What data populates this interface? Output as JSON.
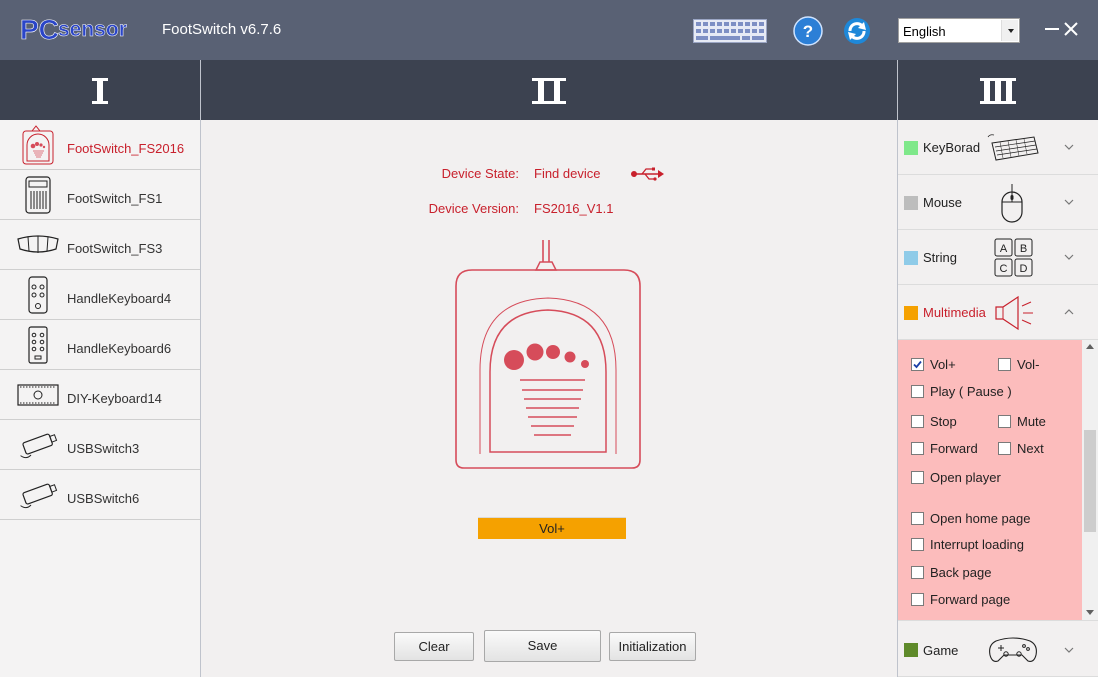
{
  "title_bar": {
    "logo_text": "PCsensor",
    "app_title": "FootSwitch v6.7.6",
    "language": "English"
  },
  "columns": {
    "left_header": "I",
    "middle_header": "II",
    "right_header": "III"
  },
  "devices": [
    {
      "label": "FootSwitch_FS2016",
      "icon": "footswitch-fs2016-icon",
      "active": true
    },
    {
      "label": "FootSwitch_FS1",
      "icon": "footswitch-fs1-icon",
      "active": false
    },
    {
      "label": "FootSwitch_FS3",
      "icon": "footswitch-fs3-icon",
      "active": false
    },
    {
      "label": "HandleKeyboard4",
      "icon": "handle-keyboard4-icon",
      "active": false
    },
    {
      "label": "HandleKeyboard6",
      "icon": "handle-keyboard6-icon",
      "active": false
    },
    {
      "label": "DIY-Keyboard14",
      "icon": "diy-keyboard14-icon",
      "active": false
    },
    {
      "label": "USBSwitch3",
      "icon": "usb-switch3-icon",
      "active": false
    },
    {
      "label": "USBSwitch6",
      "icon": "usb-switch6-icon",
      "active": false
    }
  ],
  "device_info": {
    "state_label": "Device State:",
    "state_value": "Find device",
    "version_label": "Device Version:",
    "version_value": "FS2016_V1.1"
  },
  "assigned_key": "Vol+",
  "buttons": {
    "clear": "Clear",
    "save": "Save",
    "init": "Initialization"
  },
  "categories": [
    {
      "label": "KeyBorad",
      "color": "#7fe88a",
      "icon": "keyboard-icon",
      "open": false
    },
    {
      "label": "Mouse",
      "color": "#bdbdbd",
      "icon": "mouse-icon",
      "open": false
    },
    {
      "label": "String",
      "color": "#8fcbe8",
      "icon": "string-abcd-icon",
      "open": false
    },
    {
      "label": "Multimedia",
      "color": "#f5a100",
      "icon": "speaker-icon",
      "open": true
    },
    {
      "label": "Game",
      "color": "#5f8a2a",
      "icon": "gamepad-icon",
      "open": false
    }
  ],
  "string_icon_letters": [
    "A",
    "B",
    "C",
    "D"
  ],
  "multimedia_options": [
    {
      "label": "Vol+",
      "checked": true
    },
    {
      "label": "Vol-",
      "checked": false
    },
    {
      "label": "Play ( Pause )",
      "checked": false
    },
    {
      "label": "Stop",
      "checked": false
    },
    {
      "label": "Mute",
      "checked": false
    },
    {
      "label": "Forward",
      "checked": false
    },
    {
      "label": "Next",
      "checked": false
    },
    {
      "label": "Open player",
      "checked": false
    },
    {
      "label": "Open home page",
      "checked": false
    },
    {
      "label": "Interrupt loading",
      "checked": false
    },
    {
      "label": "Back page",
      "checked": false
    },
    {
      "label": "Forward page",
      "checked": false
    }
  ],
  "colors": {
    "titlebar": "#596174",
    "header": "#3c4250",
    "accent_red": "#c8202c",
    "key_bar": "#f5a100",
    "multimedia_bg": "#fcbcbc"
  }
}
